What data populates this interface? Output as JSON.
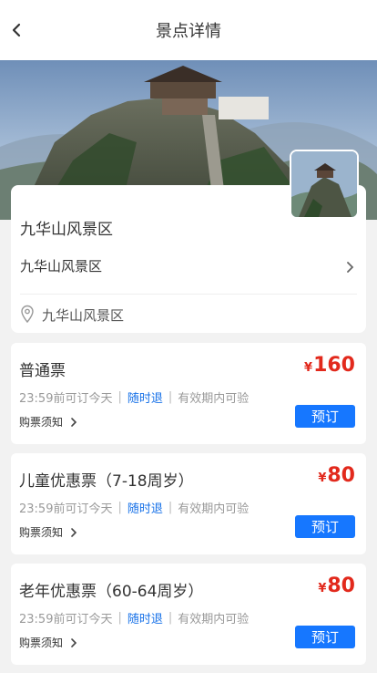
{
  "header": {
    "title": "景点详情",
    "back_icon": "chevron-left-icon"
  },
  "spot": {
    "name": "九华山风景区",
    "subtitle": "九华山风景区",
    "location": "九华山风景区",
    "location_icon": "map-pin-icon"
  },
  "tickets": [
    {
      "name": "普通票",
      "currency": "¥",
      "price": "160",
      "book_before": "23:59前可订今天",
      "refund": "随时退",
      "validity": "有效期内可验",
      "notice": "购票须知",
      "book_label": "预订"
    },
    {
      "name": "儿童优惠票（7-18周岁）",
      "currency": "¥",
      "price": "80",
      "book_before": "23:59前可订今天",
      "refund": "随时退",
      "validity": "有效期内可验",
      "notice": "购票须知",
      "book_label": "预订"
    },
    {
      "name": "老年优惠票（60-64周岁）",
      "currency": "¥",
      "price": "80",
      "book_before": "23:59前可订今天",
      "refund": "随时退",
      "validity": "有效期内可验",
      "notice": "购票须知",
      "book_label": "预订"
    }
  ],
  "colors": {
    "price": "#e2291c",
    "accent": "#1677ff",
    "refund": "#1a73e8"
  }
}
